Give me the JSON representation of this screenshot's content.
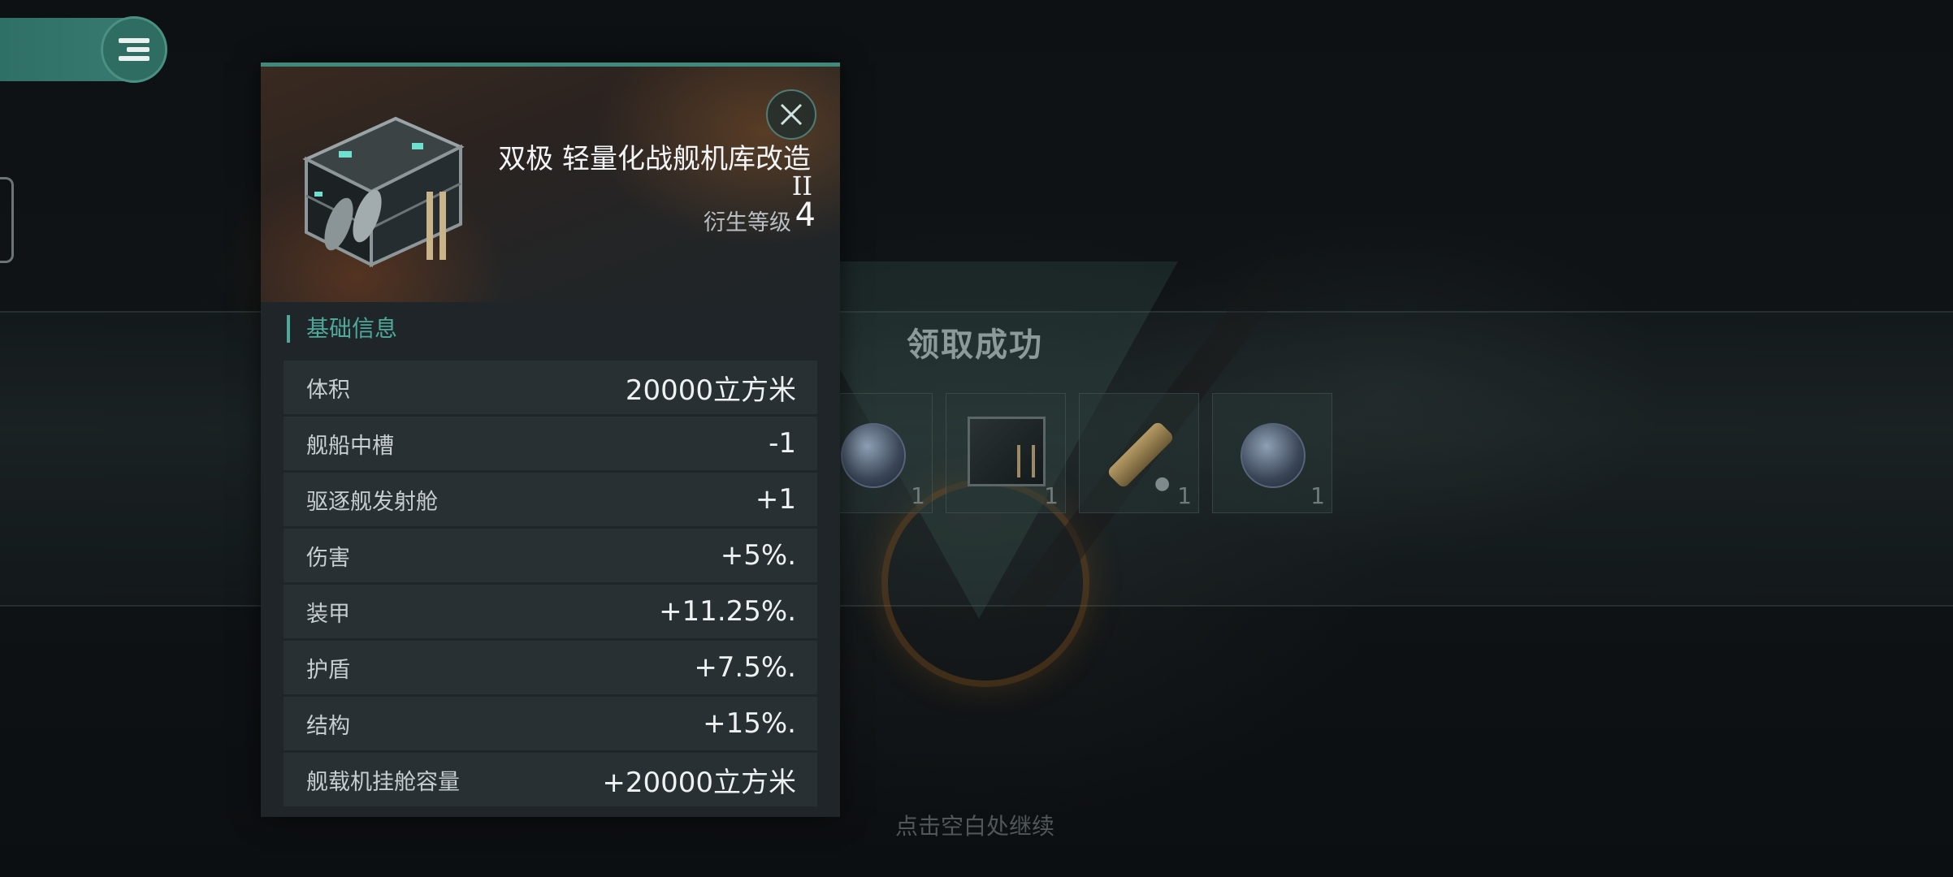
{
  "item": {
    "name": "双极 轻量化战舰机库改造",
    "tier": "II",
    "level_label": "衍生等级",
    "level_value": "4"
  },
  "section_title": "基础信息",
  "stats": [
    {
      "label": "体积",
      "value": "20000立方米"
    },
    {
      "label": "舰船中槽",
      "value": "-1"
    },
    {
      "label": "驱逐舰发射舱",
      "value": "+1"
    },
    {
      "label": "伤害",
      "value": "+5%."
    },
    {
      "label": "装甲",
      "value": "+11.25%."
    },
    {
      "label": "护盾",
      "value": "+7.5%."
    },
    {
      "label": "结构",
      "value": "+15%."
    },
    {
      "label": "舰载机挂舱容量",
      "value": "+20000立方米"
    }
  ],
  "reward_popup": {
    "title": "领取成功",
    "items": [
      {
        "icon": "fighter-orb-icon",
        "qty": "1"
      },
      {
        "icon": "hangar-module-icon",
        "qty": "1"
      },
      {
        "icon": "ammo-cylinder-icon",
        "qty": "1"
      },
      {
        "icon": "fighter-orb-icon",
        "qty": "1"
      }
    ],
    "continue_hint": "点击空白处继续"
  },
  "colors": {
    "accent": "#3e8a7d",
    "section_accent": "#4fa99a",
    "panel_bg": "#1f2528",
    "row_bg": "#293034"
  }
}
